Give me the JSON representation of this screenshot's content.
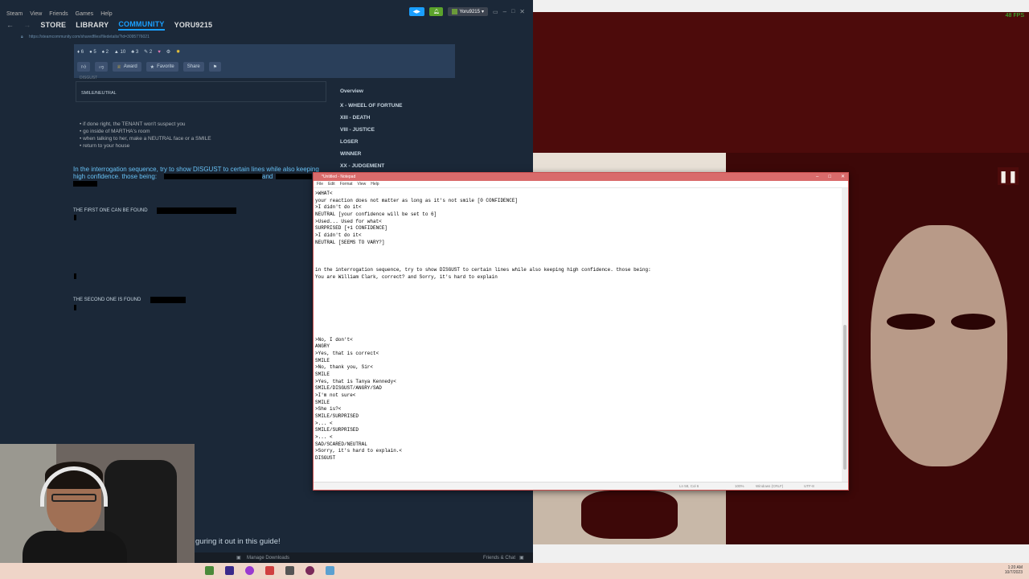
{
  "steam": {
    "menu": [
      "Steam",
      "View",
      "Friends",
      "Games",
      "Help"
    ],
    "user_chip": "Yoru9215",
    "nav": {
      "store": "STORE",
      "library": "LIBRARY",
      "community": "COMMUNITY",
      "username": "YORU9215"
    },
    "url": "https://steamcommunity.com/sharedfiles/filedetails/?id=3095776021",
    "guide_stats": [
      "6",
      "5",
      "2",
      "10",
      "3",
      "2"
    ],
    "actions": {
      "award": "Award",
      "favorite": "Favorite",
      "share": "Share"
    },
    "content": {
      "disgust_small": "DISGUST",
      "smile_neutral": "SMILE/NEUTRAL",
      "bullets": [
        "if done right, the TENANT won't suspect you",
        "go inside of MARTHA's room",
        "when talking to her, make a NEUTRAL face or a SMILE",
        "return to your house"
      ],
      "intro": "In the interrogation sequence, try to show DISGUST to certain lines while also keeping high confidence. those being:",
      "intro_and": "and",
      "first_found": "THE FIRST ONE CAN BE FOUND",
      "second_found": "THE SECOND ONE IS FOUND"
    },
    "toc": {
      "overview": "Overview",
      "items": [
        "X - WHEEL OF FORTUNE",
        "XIII - DEATH",
        "VIII - JUSTICE",
        "LOSER",
        "WINNER",
        "XX - JUDGEMENT"
      ]
    },
    "footer": {
      "manage_downloads": "Manage Downloads",
      "friends_chat": "Friends & Chat"
    },
    "guide_outro": {
      "before": "guring it out in",
      "link": " this guide!"
    }
  },
  "game": {
    "fps": "48 FPS"
  },
  "notepad": {
    "title": "*Untitled - Notepad",
    "menu": [
      "File",
      "Edit",
      "Format",
      "View",
      "Help"
    ],
    "lines": [
      ">WHAT<",
      "your reaction does not matter as long as it's not smile [0 CONFIDENCE]",
      ">I didn't do it<",
      "NEUTRAL [your confidence will be set to 6]",
      ">Used... Used for what<",
      "SURPRISED [+1 CONFIDENCE]",
      ">I didn't do it<",
      "NEUTRAL [SEEMS TO VARY?]",
      "",
      "",
      "",
      "in the interrogation sequence, try to show DISGUST to certain lines while also keeping high confidence. those being:",
      "You are William Clark, correct? and Sorry, it's hard to explain",
      "",
      "",
      "",
      "",
      "",
      "",
      "",
      "",
      ">No, I don't<",
      "ANGRY",
      ">Yes, that is correct<",
      "SMILE",
      ">No, thank you, Sir<",
      "SMILE",
      ">Yes, that is Tanya Kennedy<",
      "SMILE/DISGUST/ANGRY/SAD",
      ">I'm not sure<",
      "SMILE",
      ">She is?<",
      "SMILE/SURPRISED",
      ">... <",
      "SMILE/SURPRISED",
      ">... <",
      "SAD/SCARED/NEUTRAL",
      ">Sorry, it's hard to explain.<",
      "DISGUST"
    ],
    "status": {
      "position": "Ln 58, Col 6",
      "zoom": "100%",
      "line_ending": "Windows (CRLF)",
      "encoding": "UTF-8"
    }
  },
  "taskbar": {
    "time": "1:20 AM",
    "date": "10/7/2023"
  }
}
